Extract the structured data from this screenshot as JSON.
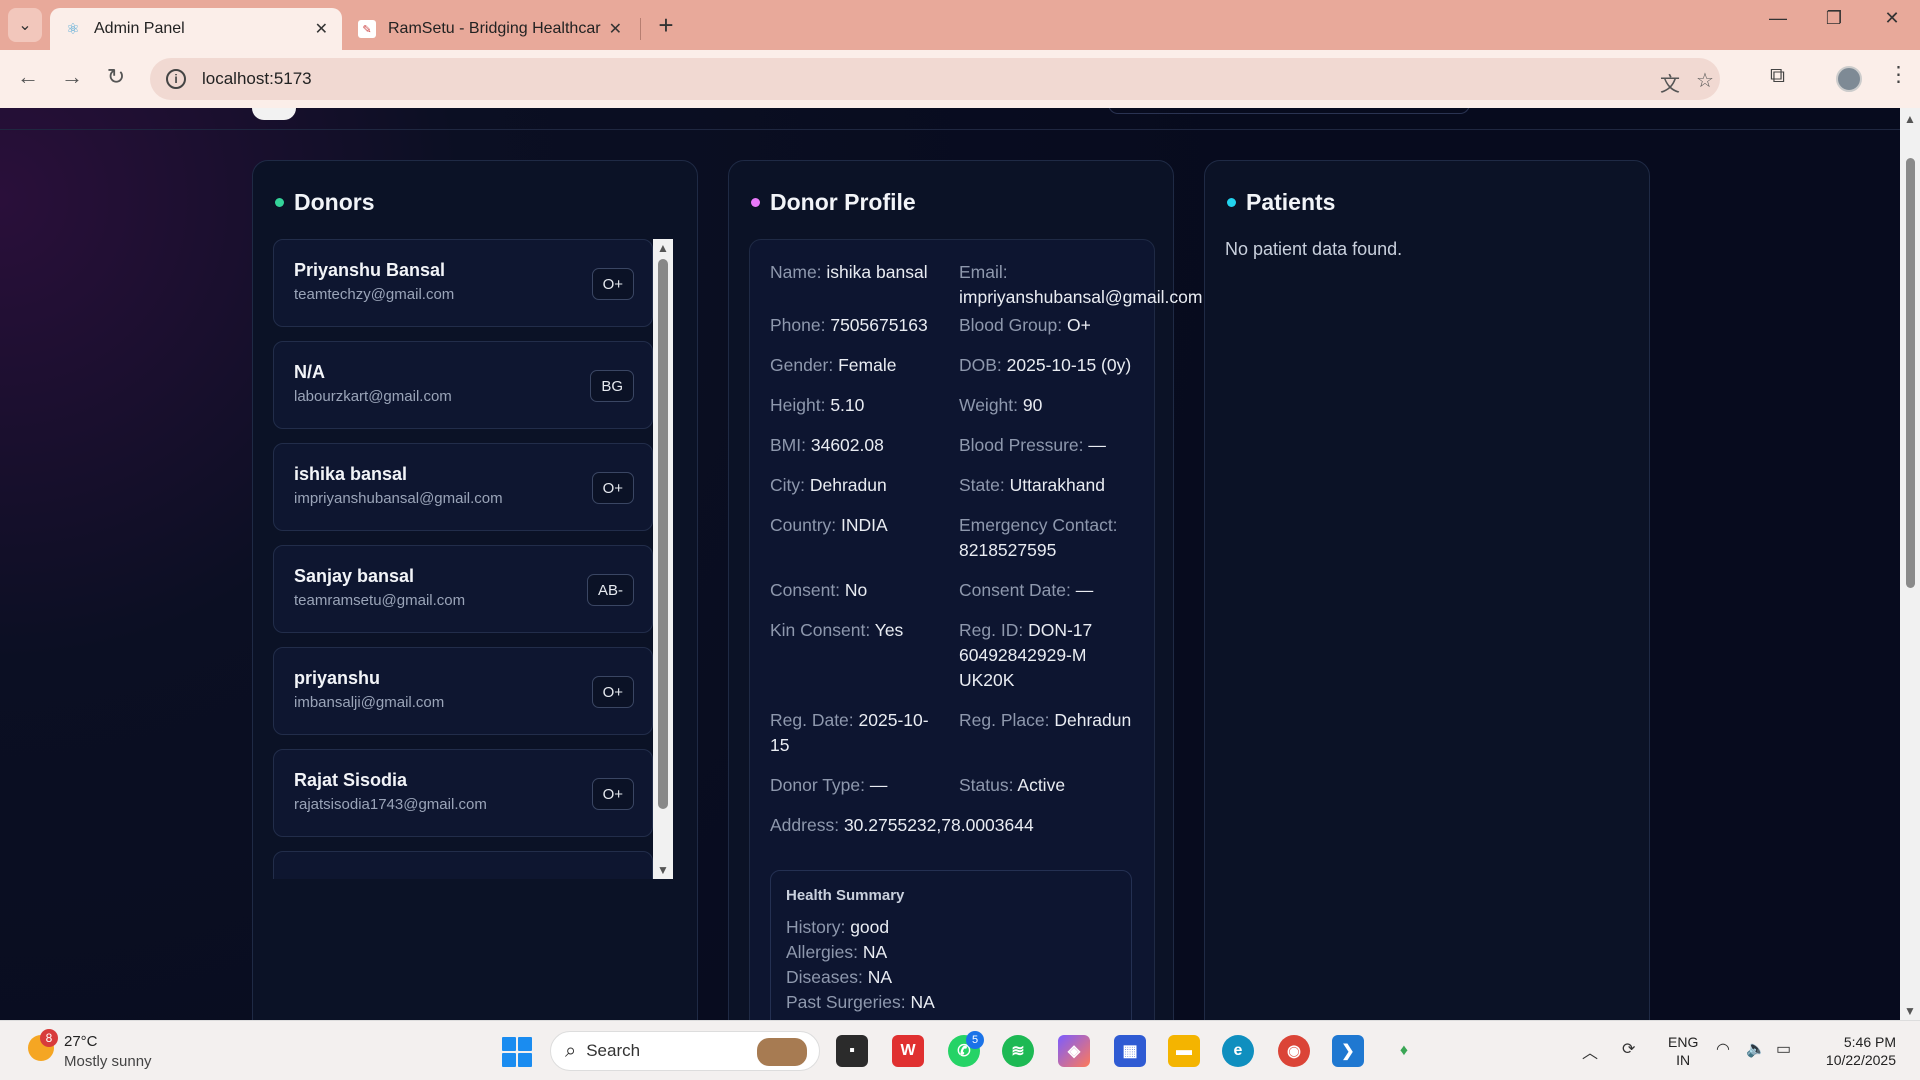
{
  "browser": {
    "tabs": [
      {
        "title": "Admin Panel",
        "active": true
      },
      {
        "title": "RamSetu - Bridging Healthcare",
        "active": false
      }
    ],
    "url": "localhost:5173"
  },
  "donors": {
    "title": "Donors",
    "items": [
      {
        "name": "Priyanshu Bansal",
        "email": "teamtechzy@gmail.com",
        "blood_group": "O+"
      },
      {
        "name": "N/A",
        "email": "labourzkart@gmail.com",
        "blood_group": "BG"
      },
      {
        "name": "ishika bansal",
        "email": "impriyanshubansal@gmail.com",
        "blood_group": "O+"
      },
      {
        "name": "Sanjay bansal",
        "email": "teamramsetu@gmail.com",
        "blood_group": "AB-"
      },
      {
        "name": "priyanshu",
        "email": "imbansalji@gmail.com",
        "blood_group": "O+"
      },
      {
        "name": "Rajat Sisodia",
        "email": "rajatsisodia1743@gmail.com",
        "blood_group": "O+"
      }
    ]
  },
  "profile": {
    "title": "Donor Profile",
    "fields": {
      "name": {
        "label": "Name:",
        "value": "ishika bansal"
      },
      "email": {
        "label": "Email:",
        "value": "impriyanshubansal@gmail.com"
      },
      "phone": {
        "label": "Phone:",
        "value": "7505675163"
      },
      "blood_group": {
        "label": "Blood Group:",
        "value": "O+"
      },
      "gender": {
        "label": "Gender:",
        "value": "Female"
      },
      "dob": {
        "label": "DOB:",
        "value": "2025-10-15 (0y)"
      },
      "height": {
        "label": "Height:",
        "value": "5.10"
      },
      "weight": {
        "label": "Weight:",
        "value": "90"
      },
      "bmi": {
        "label": "BMI:",
        "value": "34602.08"
      },
      "bp": {
        "label": "Blood Pressure:",
        "value": "—"
      },
      "city": {
        "label": "City:",
        "value": "Dehradun"
      },
      "state": {
        "label": "State:",
        "value": "Uttarakhand"
      },
      "country": {
        "label": "Country:",
        "value": "INDIA"
      },
      "emergency": {
        "label": "Emergency Contact:",
        "value": "8218527595"
      },
      "consent": {
        "label": "Consent:",
        "value": "No"
      },
      "consent_date": {
        "label": "Consent Date:",
        "value": "—"
      },
      "kin_consent": {
        "label": "Kin Consent:",
        "value": "Yes"
      },
      "reg_id": {
        "label": "Reg. ID:",
        "value": "DON-1760492842929-MUK20K"
      },
      "reg_date": {
        "label": "Reg. Date:",
        "value": "2025-10-15"
      },
      "reg_place": {
        "label": "Reg. Place:",
        "value": "Dehradun"
      },
      "donor_type": {
        "label": "Donor Type:",
        "value": "—"
      },
      "status": {
        "label": "Status:",
        "value": "Active"
      },
      "address": {
        "label": "Address:",
        "value": "30.2755232,78.0003644"
      }
    },
    "health": {
      "title": "Health Summary",
      "history": {
        "label": "History:",
        "value": "good"
      },
      "allergies": {
        "label": "Allergies:",
        "value": "NA"
      },
      "diseases": {
        "label": "Diseases:",
        "value": "NA"
      },
      "surgeries": {
        "label": "Past Surgeries:",
        "value": "NA"
      }
    }
  },
  "patients": {
    "title": "Patients",
    "empty": "No patient data found."
  },
  "taskbar": {
    "weather_badge": "8",
    "temp": "27°C",
    "condition": "Mostly sunny",
    "search": "Search",
    "whatsapp_badge": "5",
    "lang1": "ENG",
    "lang2": "IN",
    "time": "5:46 PM",
    "date": "10/22/2025"
  },
  "colors": {
    "donors_dot": "#34d399",
    "profile_dot": "#e879f9",
    "patients_dot": "#22d3ee"
  }
}
